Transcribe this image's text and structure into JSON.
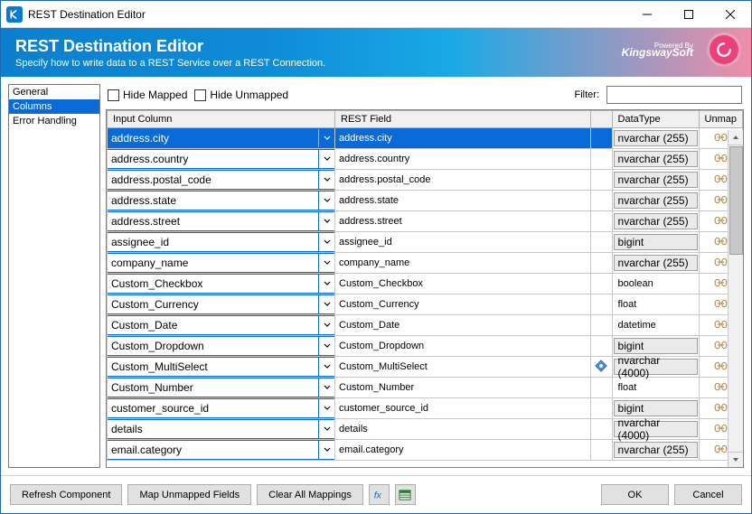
{
  "title": "REST Destination Editor",
  "banner": {
    "heading": "REST Destination Editor",
    "sub": "Specify how to write data to a REST Service over a REST Connection.",
    "poweredBy": "Powered By",
    "ksLogo": "KingswaySoft"
  },
  "nav": {
    "items": [
      {
        "label": "General",
        "selected": false
      },
      {
        "label": "Columns",
        "selected": true
      },
      {
        "label": "Error Handling",
        "selected": false
      }
    ]
  },
  "toolbar": {
    "hideMapped": "Hide Mapped",
    "hideUnmapped": "Hide Unmapped",
    "filterLabel": "Filter:"
  },
  "grid": {
    "headers": {
      "input": "Input Column",
      "rest": "REST Field",
      "dt": "DataType",
      "unmap": "Unmap"
    },
    "rows": [
      {
        "input": "address.city",
        "rest": "address.city",
        "dt": "nvarchar (255)",
        "box": true,
        "hl": true,
        "ind": false
      },
      {
        "input": "address.country",
        "rest": "address.country",
        "dt": "nvarchar (255)",
        "box": true,
        "hl": false,
        "ind": false
      },
      {
        "input": "address.postal_code",
        "rest": "address.postal_code",
        "dt": "nvarchar (255)",
        "box": true,
        "hl": false,
        "ind": false
      },
      {
        "input": "address.state",
        "rest": "address.state",
        "dt": "nvarchar (255)",
        "box": true,
        "hl": false,
        "ind": false
      },
      {
        "input": "address.street",
        "rest": "address.street",
        "dt": "nvarchar (255)",
        "box": true,
        "hl": false,
        "ind": false
      },
      {
        "input": "assignee_id",
        "rest": "assignee_id",
        "dt": "bigint",
        "box": true,
        "hl": false,
        "ind": false
      },
      {
        "input": "company_name",
        "rest": "company_name",
        "dt": "nvarchar (255)",
        "box": true,
        "hl": false,
        "ind": false
      },
      {
        "input": "Custom_Checkbox",
        "rest": "Custom_Checkbox",
        "dt": "boolean",
        "box": false,
        "hl": false,
        "ind": false
      },
      {
        "input": "Custom_Currency",
        "rest": "Custom_Currency",
        "dt": "float",
        "box": false,
        "hl": false,
        "ind": false
      },
      {
        "input": "Custom_Date",
        "rest": "Custom_Date",
        "dt": "datetime",
        "box": false,
        "hl": false,
        "ind": false
      },
      {
        "input": "Custom_Dropdown",
        "rest": "Custom_Dropdown",
        "dt": "bigint",
        "box": true,
        "hl": false,
        "ind": false
      },
      {
        "input": "Custom_MultiSelect",
        "rest": "Custom_MultiSelect",
        "dt": "nvarchar (4000)",
        "box": true,
        "hl": false,
        "ind": true
      },
      {
        "input": "Custom_Number",
        "rest": "Custom_Number",
        "dt": "float",
        "box": false,
        "hl": false,
        "ind": false
      },
      {
        "input": "customer_source_id",
        "rest": "customer_source_id",
        "dt": "bigint",
        "box": true,
        "hl": false,
        "ind": false
      },
      {
        "input": "details",
        "rest": "details",
        "dt": "nvarchar (4000)",
        "box": true,
        "hl": false,
        "ind": false
      },
      {
        "input": "email.category",
        "rest": "email.category",
        "dt": "nvarchar (255)",
        "box": true,
        "hl": false,
        "ind": false
      }
    ]
  },
  "footer": {
    "refresh": "Refresh Component",
    "mapUnmapped": "Map Unmapped Fields",
    "clearAll": "Clear All Mappings",
    "ok": "OK",
    "cancel": "Cancel"
  }
}
